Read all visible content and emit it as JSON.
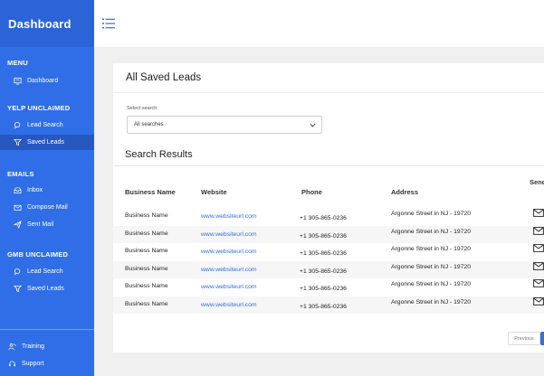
{
  "brand": {
    "title": "Dashboard"
  },
  "sidebar": {
    "sections": [
      {
        "title": "MENU",
        "items": [
          {
            "label": "Dashboard",
            "icon": "dashboard-icon"
          }
        ]
      },
      {
        "title": "YELP UNCLAIMED",
        "items": [
          {
            "label": "Lead Search",
            "icon": "search-icon"
          },
          {
            "label": "Saved Leads",
            "icon": "filter-icon",
            "active": true
          }
        ]
      },
      {
        "title": "EMAILS",
        "items": [
          {
            "label": "Inbox",
            "icon": "inbox-icon"
          },
          {
            "label": "Compose Mail",
            "icon": "compose-icon"
          },
          {
            "label": "Sent Mail",
            "icon": "send-icon"
          }
        ]
      },
      {
        "title": "GMB UNCLAIMED",
        "items": [
          {
            "label": "Lead Search",
            "icon": "search-icon"
          },
          {
            "label": "Saved Leads",
            "icon": "filter-icon"
          }
        ]
      }
    ],
    "footer": [
      {
        "label": "Training",
        "icon": "training-icon"
      },
      {
        "label": "Support",
        "icon": "support-icon"
      }
    ]
  },
  "page": {
    "title": "All Saved Leads",
    "select_label": "Select search:",
    "select_value": "All searches",
    "results_title": "Search Results"
  },
  "table": {
    "headers": {
      "business": "Business Name",
      "website": "Website",
      "phone": "Phone",
      "address": "Address",
      "send_email": "Send Email"
    },
    "rows": [
      {
        "business": "Business Name",
        "website": "www.websiteurl.com",
        "phone": "+1 305-865-0236",
        "address": "Argonne Street in NJ - 19720"
      },
      {
        "business": "Business Name",
        "website": "www.websiteurl.com",
        "phone": "+1 305-865-0236",
        "address": "Argonne Street in NJ - 19720"
      },
      {
        "business": "Business Name",
        "website": "www.websiteurl.com",
        "phone": "+1 305-865-0236",
        "address": "Argonne Street in NJ - 19720"
      },
      {
        "business": "Business Name",
        "website": "www.websiteurl.com",
        "phone": "+1 305-865-0236",
        "address": "Argonne Street in NJ - 19720"
      },
      {
        "business": "Business Name",
        "website": "www.websiteurl.com",
        "phone": "+1 305-865-0236",
        "address": "Argonne Street in NJ - 19720"
      },
      {
        "business": "Business Name",
        "website": "www.websiteurl.com",
        "phone": "+1 305-865-0236",
        "address": "Argonne Street in NJ - 19720"
      }
    ]
  },
  "pagination": {
    "previous_label": "Previous"
  },
  "colors": {
    "sidebar": "#2f6ee6",
    "active_item": "#2658c0",
    "link": "#2f6ee6"
  }
}
